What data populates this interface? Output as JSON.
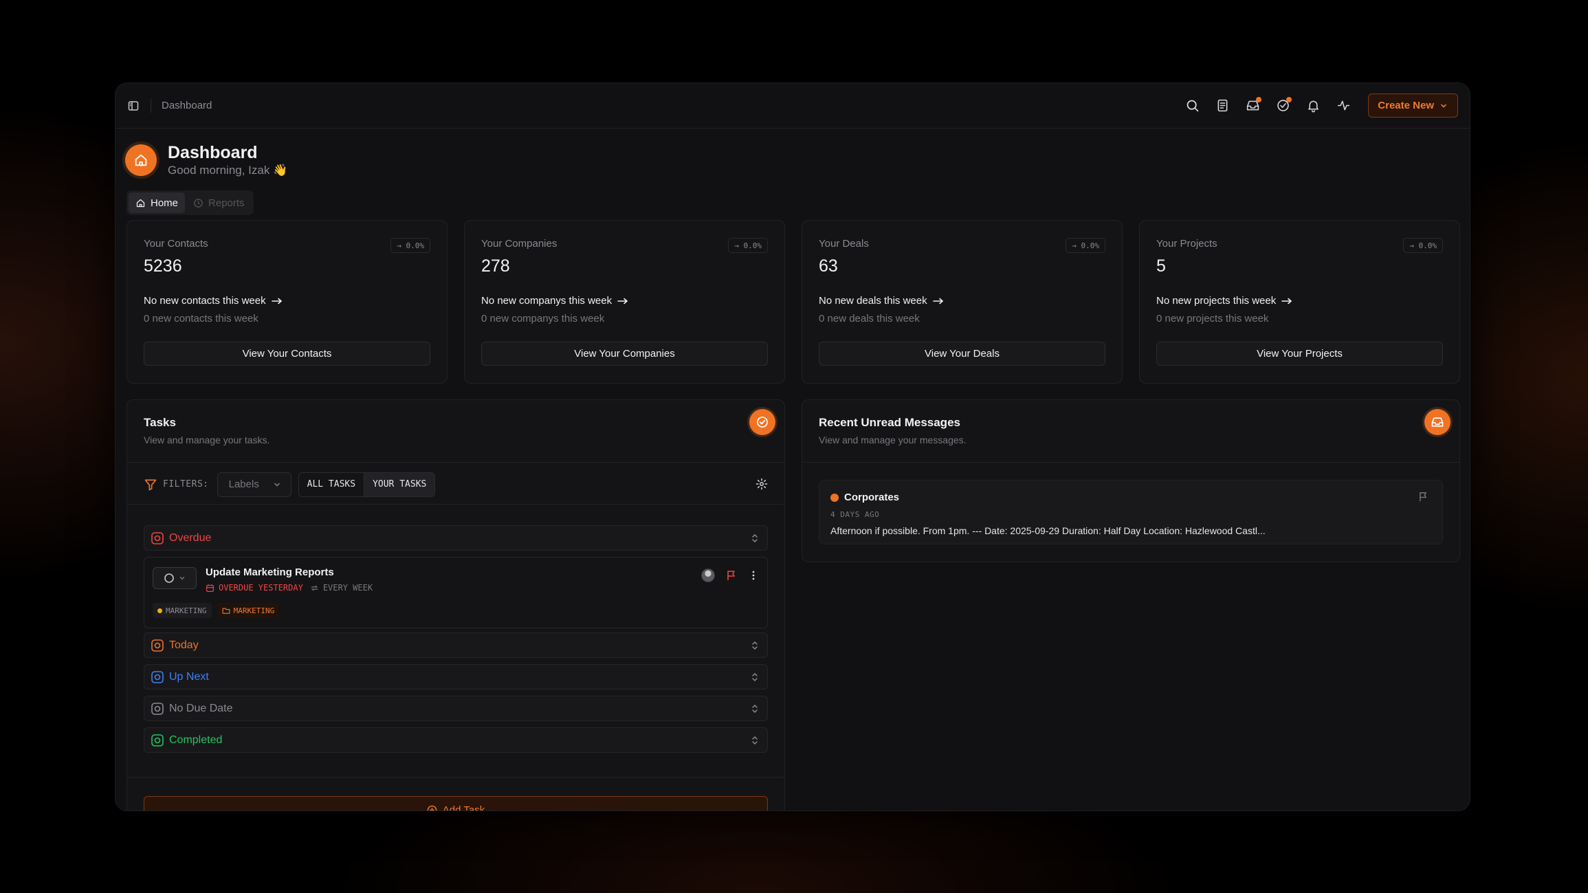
{
  "topbar": {
    "breadcrumb": "Dashboard",
    "create_label": "Create New"
  },
  "header": {
    "title": "Dashboard",
    "greeting": "Good morning, Izak 👋"
  },
  "tabs": [
    {
      "label": "Home",
      "active": true
    },
    {
      "label": "Reports",
      "active": false
    }
  ],
  "stats": [
    {
      "label": "Your Contacts",
      "value": "5236",
      "change": "→ 0.0%",
      "headline": "No new contacts this week",
      "sub": "0 new contacts this week",
      "button": "View Your Contacts"
    },
    {
      "label": "Your Companies",
      "value": "278",
      "change": "→ 0.0%",
      "headline": "No new companys this week",
      "sub": "0 new companys this week",
      "button": "View Your Companies"
    },
    {
      "label": "Your Deals",
      "value": "63",
      "change": "→ 0.0%",
      "headline": "No new deals this week",
      "sub": "0 new deals this week",
      "button": "View Your Deals"
    },
    {
      "label": "Your Projects",
      "value": "5",
      "change": "→ 0.0%",
      "headline": "No new projects this week",
      "sub": "0 new projects this week",
      "button": "View Your Projects"
    }
  ],
  "tasks": {
    "title": "Tasks",
    "subtitle": "View and manage your tasks.",
    "filters_label": "FILTERS:",
    "labels_select": "Labels",
    "segment_all": "ALL TASKS",
    "segment_yours": "YOUR TASKS",
    "groups": [
      {
        "label": "Overdue",
        "color": "#ef4444"
      },
      {
        "label": "Today",
        "color": "#f07324"
      },
      {
        "label": "Up Next",
        "color": "#3b82f6"
      },
      {
        "label": "No Due Date",
        "color": "#8a8a92"
      },
      {
        "label": "Completed",
        "color": "#22c55e"
      }
    ],
    "item": {
      "title": "Update Marketing Reports",
      "due": "OVERDUE YESTERDAY",
      "repeat": "EVERY WEEK",
      "label_chip": "MARKETING",
      "project_chip": "MARKETING"
    },
    "add_task": "Add Task"
  },
  "messages": {
    "title": "Recent Unread Messages",
    "subtitle": "View and manage your messages.",
    "item": {
      "sender": "Corporates",
      "time": "4 DAYS AGO",
      "preview": "Afternoon if possible. From 1pm. --- Date: 2025-09-29 Duration: Half Day Location: Hazlewood Castl..."
    }
  },
  "colors": {
    "accent": "#f07324",
    "overdue": "#ef4444",
    "up_next": "#3b82f6",
    "completed": "#22c55e"
  }
}
